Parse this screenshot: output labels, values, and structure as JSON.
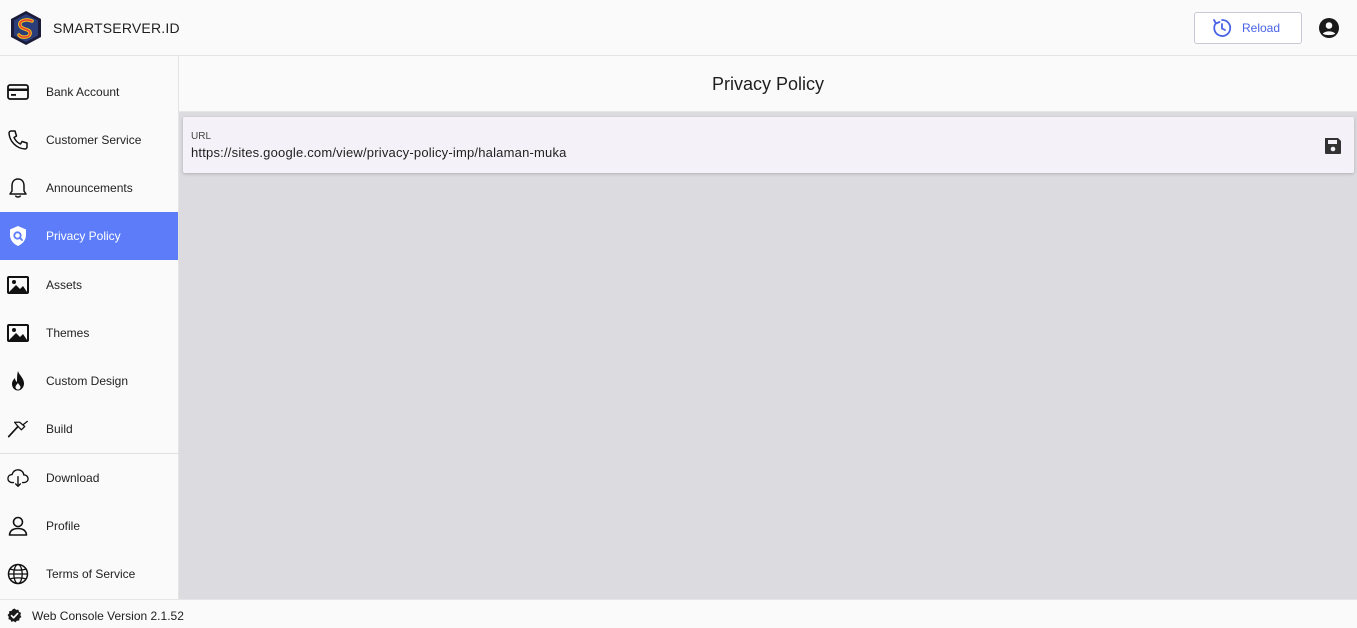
{
  "header": {
    "brand": "SMARTSERVER.ID",
    "reload_label": "Reload",
    "logo_icon": "smartserver-logo",
    "reload_icon": "reload-clock-icon",
    "account_icon": "account-circle-icon",
    "accent_color": "#4a63e6"
  },
  "sidebar": {
    "active_color": "#5c7cfa",
    "items": [
      {
        "label": "Bank Account",
        "icon": "credit-card-icon"
      },
      {
        "label": "Customer Service",
        "icon": "phone-icon"
      },
      {
        "label": "Announcements",
        "icon": "bell-icon"
      },
      {
        "label": "Privacy Policy",
        "icon": "shield-search-icon",
        "active": true
      },
      {
        "label": "Assets",
        "icon": "image-icon"
      },
      {
        "label": "Themes",
        "icon": "image-icon"
      },
      {
        "label": "Custom Design",
        "icon": "flame-icon"
      },
      {
        "label": "Build",
        "icon": "hammer-icon"
      },
      {
        "label": "Download",
        "icon": "cloud-download-icon"
      },
      {
        "label": "Profile",
        "icon": "person-icon"
      },
      {
        "label": "Terms of Service",
        "icon": "globe-icon"
      }
    ]
  },
  "main": {
    "title": "Privacy Policy",
    "url_field": {
      "label": "URL",
      "value": "https://sites.google.com/view/privacy-policy-imp/halaman-muka",
      "action_icon": "save-icon"
    }
  },
  "footer": {
    "version": "Web Console Version 2.1.52",
    "icon": "verified-check-icon"
  }
}
